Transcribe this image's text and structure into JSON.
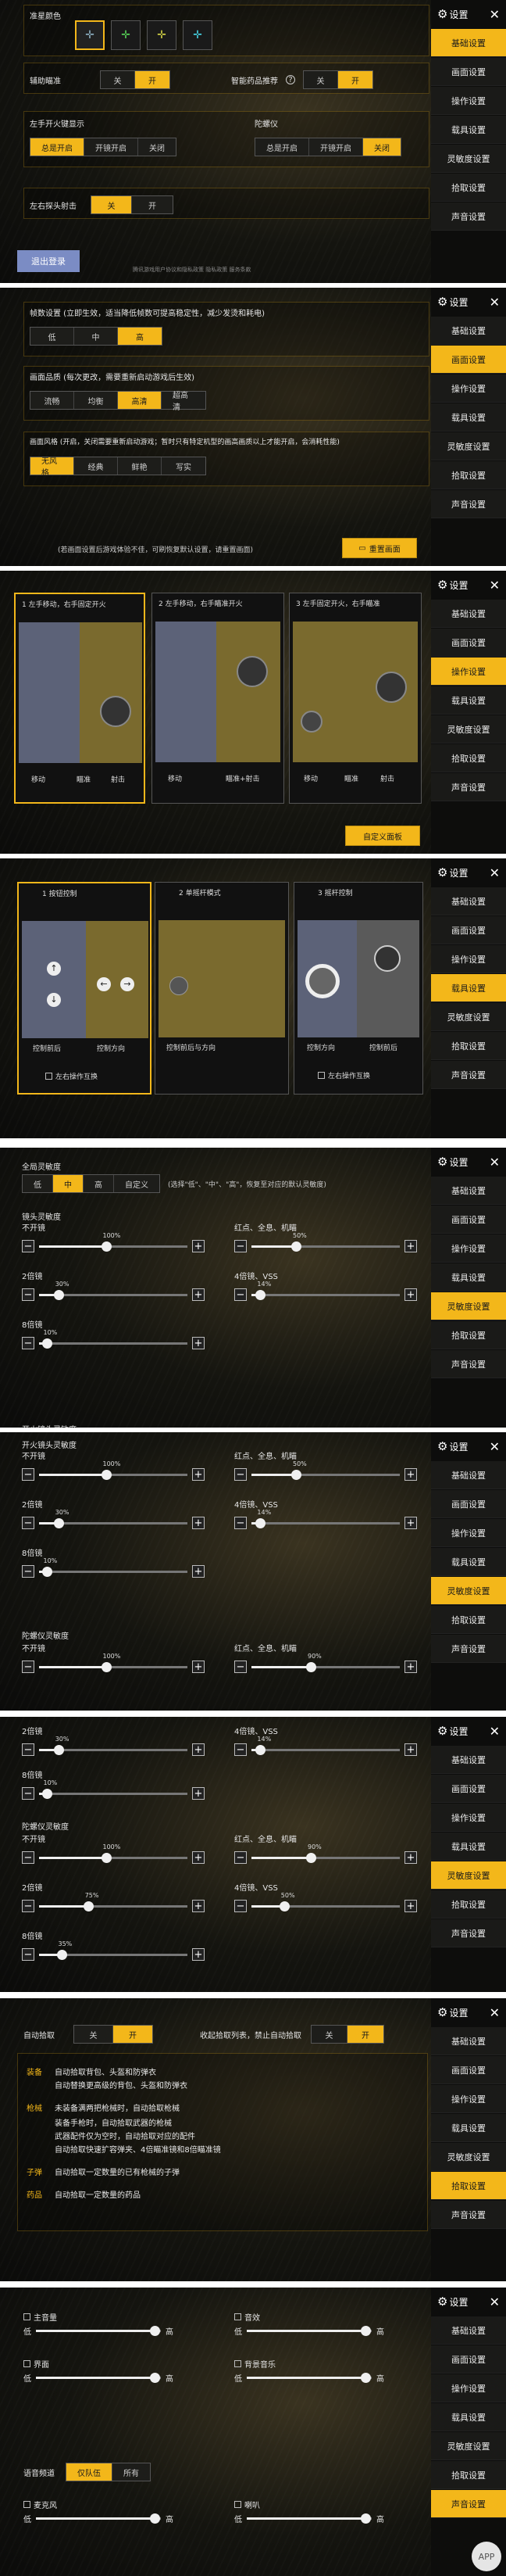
{
  "sidebar": {
    "title": "设置",
    "items": [
      "基础设置",
      "画面设置",
      "操作设置",
      "载具设置",
      "灵敏度设置",
      "拾取设置",
      "声音设置"
    ]
  },
  "icons": {
    "gear": "gear-icon",
    "close": "close-icon"
  },
  "colors": {
    "accent": "#f3b71a"
  },
  "basic": {
    "crosshair_label": "准星颜色",
    "aim_assist_label": "辅助瞄准",
    "off": "关",
    "on": "开",
    "smart_med_label": "智能药品推荐",
    "left_fire_label": "左手开火键显示",
    "always_on": "总是开启",
    "open_mirror": "开镜开启",
    "close": "关闭",
    "gyro_label": "陀螺仪",
    "lean_fire_label": "左右探头射击",
    "logout": "退出登录",
    "footer_links": "腾讯游戏用户协议和隐私政策 隐私政策 服务条款"
  },
  "graphics": {
    "frame_label": "帧数设置 (立即生效，适当降低帧数可提高稳定性，减少发烫和耗电)",
    "frame_options": [
      "低",
      "中",
      "高"
    ],
    "frame_selected": 2,
    "quality_label": "画面品质 (每次更改，需要重新启动游戏后生效)",
    "quality_options": [
      "流畅",
      "均衡",
      "高清",
      "超高清"
    ],
    "quality_selected": 2,
    "style_label": "画面风格 (开启，关闭需要重新启动游戏；暂时只有特定机型的画高画质以上才能开启，会消耗性能)",
    "style_options": [
      "无风格",
      "经典",
      "鲜艳",
      "写实"
    ],
    "style_selected": 0,
    "note": "(若画面设置后游戏体验不佳，可刷恢复默认设置，请重置画面)",
    "reset": "重置画面"
  },
  "operation": {
    "cards": [
      {
        "n": "1",
        "title": "左手移动，右手固定开火",
        "captions": [
          "移动",
          "瞄准",
          "射击"
        ]
      },
      {
        "n": "2",
        "title": "左手移动，右手瞄准开火",
        "captions": [
          "移动",
          "瞄准+射击"
        ]
      },
      {
        "n": "3",
        "title": "左手固定开火，右手瞄准",
        "captions": [
          "移动",
          "瞄准",
          "射击"
        ]
      }
    ],
    "custom": "自定义面板"
  },
  "vehicle": {
    "cards": [
      {
        "n": "1",
        "title": "按钮控制",
        "captions": [
          "控制前后",
          "控制方向"
        ]
      },
      {
        "n": "2",
        "title": "单摇杆模式",
        "captions": [
          "控制前后与方向"
        ]
      },
      {
        "n": "3",
        "title": "摇杆控制",
        "captions": [
          "控制方向",
          "控制前后"
        ]
      }
    ],
    "swap_label": "左右操作互换"
  },
  "sensitivity": {
    "global_label": "全局灵敏度",
    "global_options": [
      "低",
      "中",
      "高",
      "自定义"
    ],
    "global_selected": 1,
    "global_note": "(选择\"低\"、\"中\"、\"高\"，恢复至对应的默认灵敏度)",
    "camera_title": "镜头灵敏度",
    "camera_free_title": "开火镜头灵敏度",
    "gyro_title": "陀螺仪灵敏度",
    "no_scope": "不开镜",
    "red_dot": "红点、全息、机瞄",
    "x2": "2倍镜",
    "x4": "4倍镜、VSS",
    "x8": "8倍镜",
    "lo": "−",
    "hi": "+",
    "cam_values": {
      "no_scope": "100%",
      "red_dot": "50%",
      "x2": "30%",
      "x4": "14%",
      "x8": "10%"
    },
    "cam_fractions": {
      "no_scope": 0.45,
      "red_dot": 0.3,
      "x2": 0.13,
      "x4": 0.06,
      "x8": 0.05
    },
    "gyro_values": {
      "no_scope": "100%",
      "red_dot": "90%",
      "x2": "75%",
      "x4": "50%",
      "x8": "35%"
    },
    "gyro_fractions": {
      "no_scope": 0.45,
      "red_dot": 0.4,
      "x2": 0.33,
      "x4": 0.22,
      "x8": 0.15
    }
  },
  "pickup": {
    "auto_label": "自动拾取",
    "limit_label": "收起拾取列表，禁止自动拾取",
    "off": "关",
    "on": "开",
    "lines": [
      {
        "k": "装备",
        "t": "自动拾取背包、头盔和防弹衣"
      },
      {
        "k": "",
        "t": "自动替换更高级的背包、头盔和防弹衣"
      },
      {
        "k": "枪械",
        "t": "未装备满两把枪械时，自动拾取枪械"
      },
      {
        "k": "",
        "t": "装备手枪时，自动拾取武器的枪械"
      },
      {
        "k": "",
        "t": "武器配件仅为空时，自动拾取对应的配件"
      },
      {
        "k": "",
        "t": "自动拾取快速扩容弹夹、4倍瞄准镜和8倍瞄准镜"
      },
      {
        "k": "子弹",
        "t": "自动拾取一定数量的已有枪械的子弹"
      },
      {
        "k": "药品",
        "t": "自动拾取一定数量的药品"
      }
    ]
  },
  "sound": {
    "main_volume": "主音量",
    "sfx": "音效",
    "ui": "界面",
    "bgm": "背景音乐",
    "low": "低",
    "high": "高",
    "voice_label": "语音频道",
    "voice_options": [
      "仅队伍",
      "所有"
    ],
    "voice_selected": 0,
    "mic": "麦克风",
    "speaker": "喇叭",
    "levels": {
      "main": 0.95,
      "sfx": 0.95,
      "ui": 0.95,
      "bgm": 0.95,
      "mic": 0.95,
      "speaker": 0.95
    }
  },
  "watermark": "APP"
}
